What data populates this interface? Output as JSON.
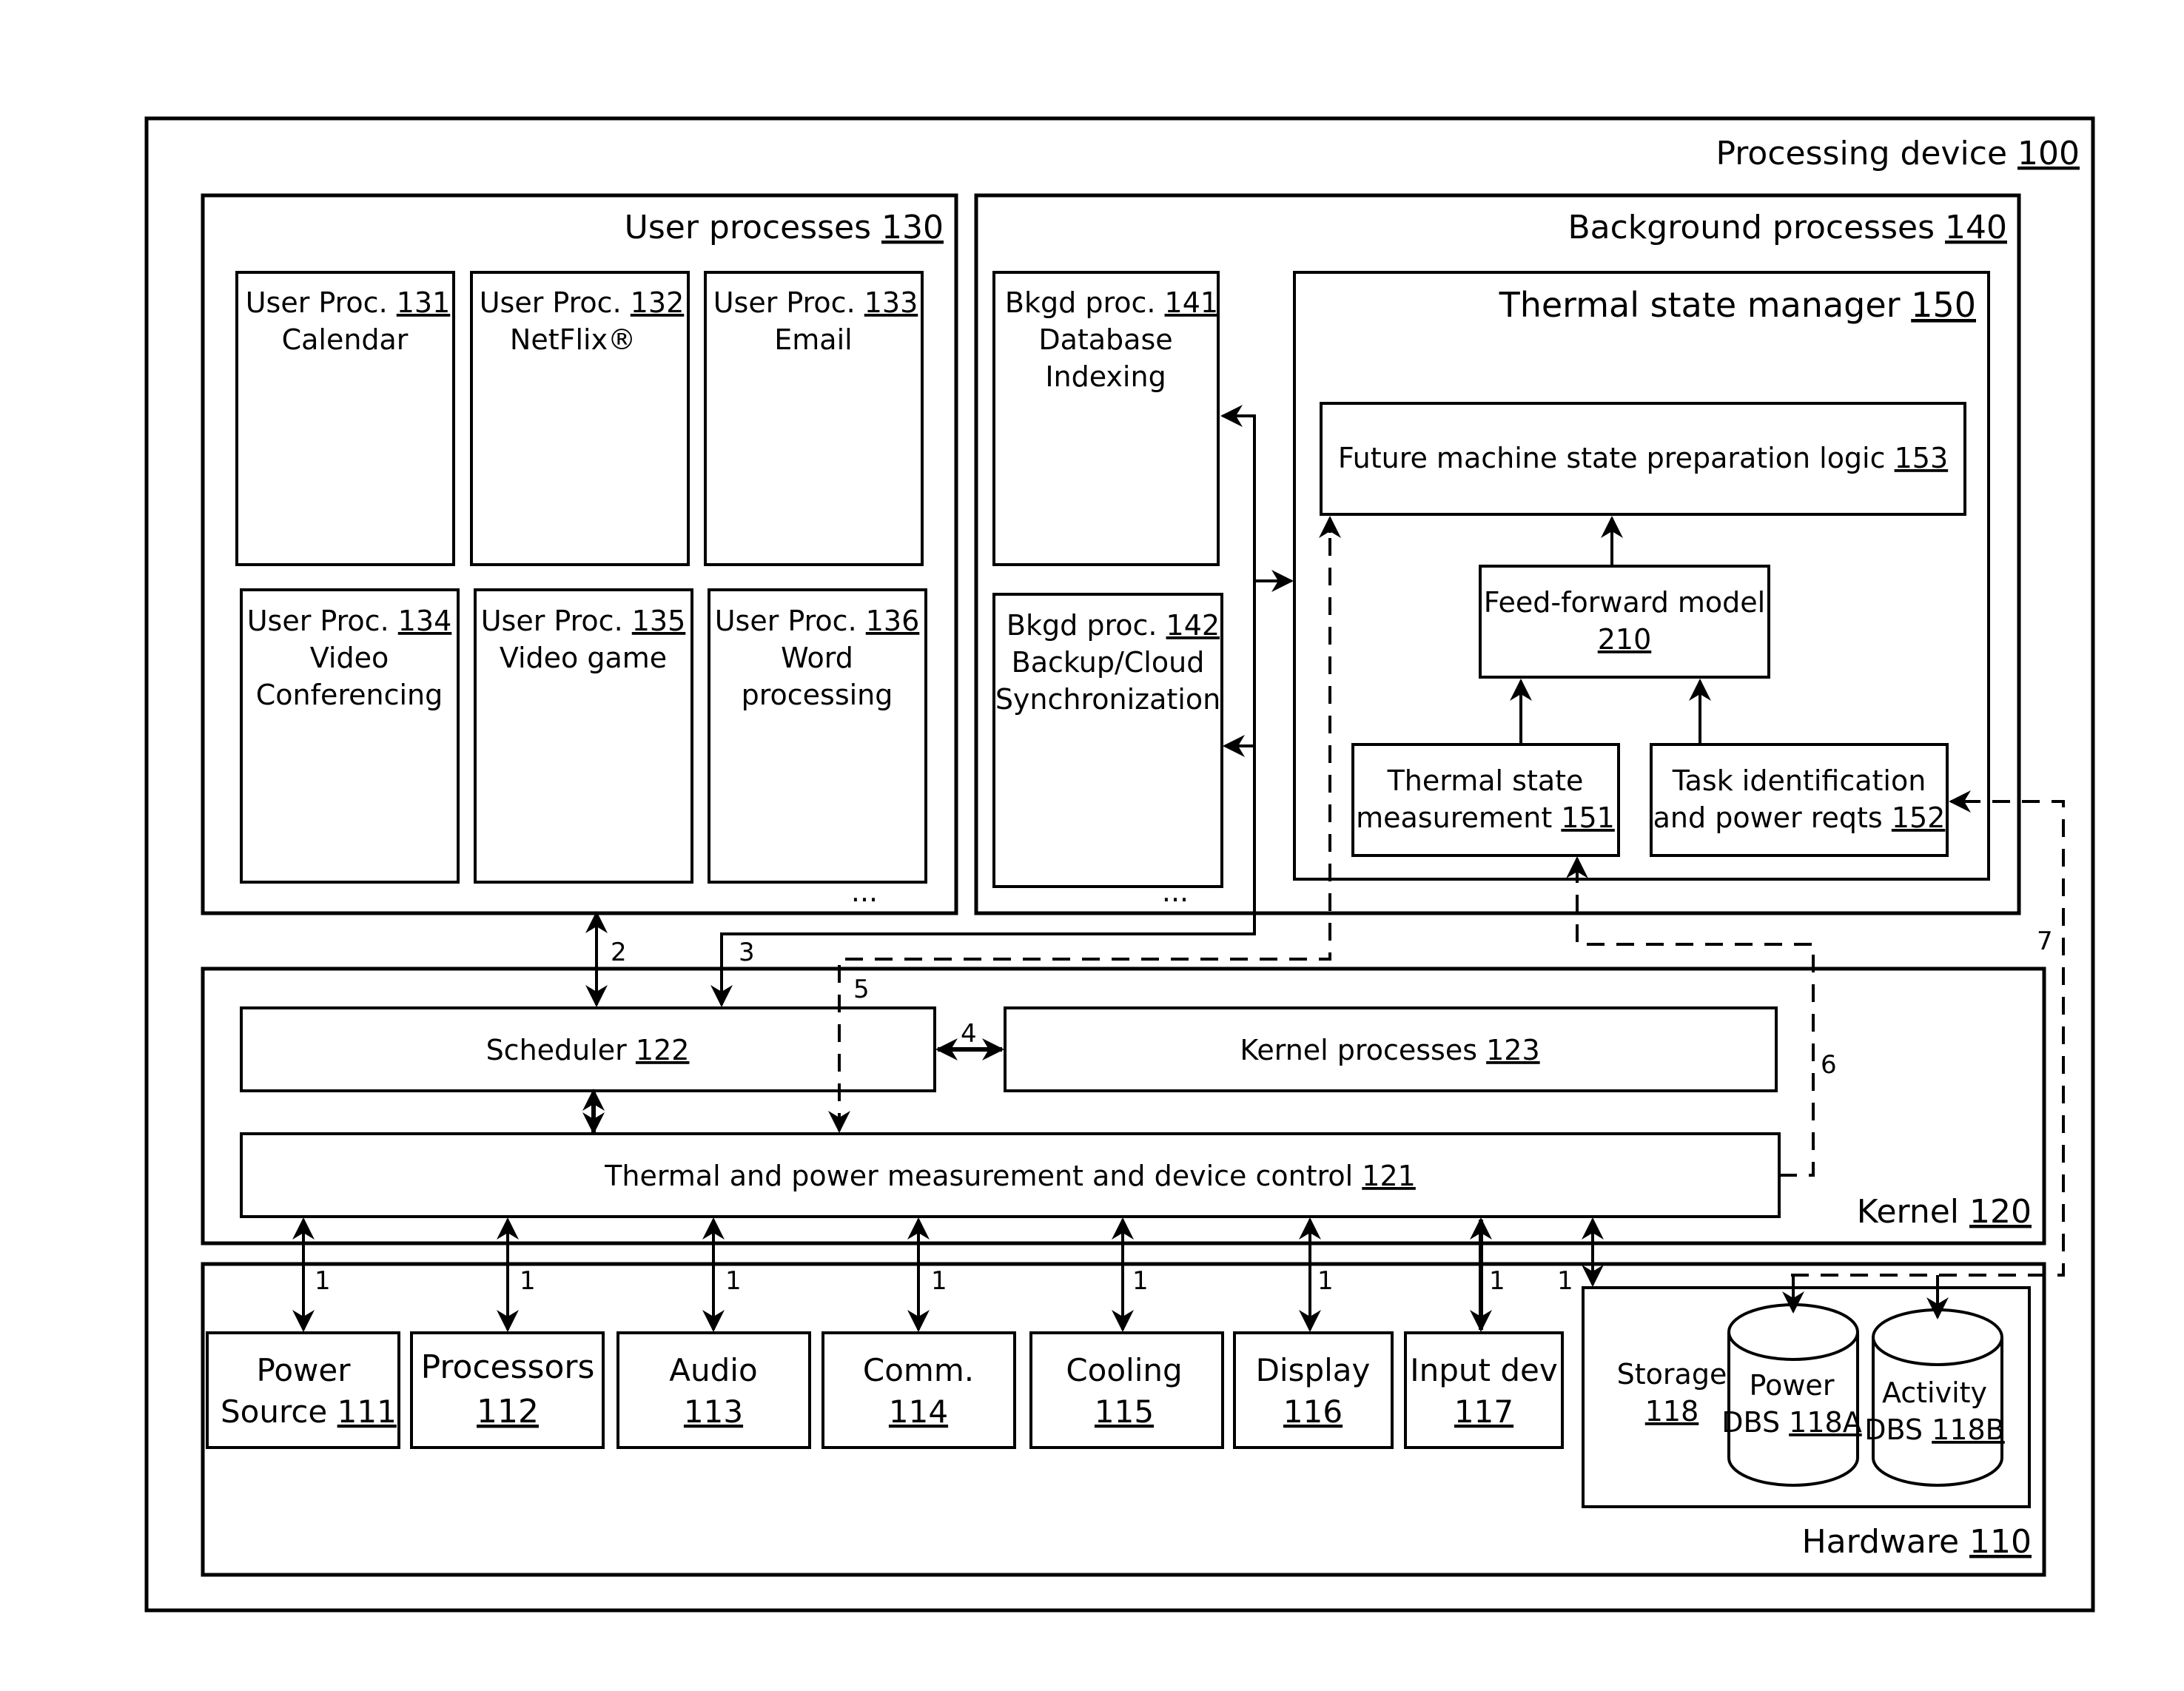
{
  "device": {
    "label": "Processing device",
    "ref": "100"
  },
  "user_processes": {
    "label": "User processes",
    "ref": "130",
    "items": [
      {
        "label": "User Proc.",
        "ref": "131",
        "lines": [
          "Calendar"
        ]
      },
      {
        "label": "User Proc.",
        "ref": "132",
        "lines": [
          "NetFlix®"
        ]
      },
      {
        "label": "User Proc.",
        "ref": "133",
        "lines": [
          "Email"
        ]
      },
      {
        "label": "User Proc.",
        "ref": "134",
        "lines": [
          "Video",
          "Conferencing"
        ]
      },
      {
        "label": "User Proc.",
        "ref": "135",
        "lines": [
          "Video game"
        ]
      },
      {
        "label": "User Proc.",
        "ref": "136",
        "lines": [
          "Word",
          "processing"
        ]
      }
    ],
    "ellipsis": "..."
  },
  "background_processes": {
    "label": "Background processes",
    "ref": "140",
    "items": [
      {
        "label": "Bkgd proc.",
        "ref": "141",
        "lines": [
          "Database",
          "Indexing"
        ]
      },
      {
        "label": "Bkgd proc.",
        "ref": "142",
        "lines": [
          "Backup/Cloud",
          "Synchronization"
        ]
      }
    ],
    "ellipsis": "..."
  },
  "thermal_state_manager": {
    "label": "Thermal state manager",
    "ref": "150",
    "future_logic": {
      "label": "Future machine state preparation logic",
      "ref": "153"
    },
    "feed_forward": {
      "label": "Feed-forward model",
      "ref": "210"
    },
    "thermal_measurement": {
      "lines": [
        "Thermal state",
        "measurement"
      ],
      "ref": "151"
    },
    "task_identification": {
      "lines": [
        "Task identification",
        "and power reqts"
      ],
      "ref": "152"
    }
  },
  "kernel": {
    "label": "Kernel",
    "ref": "120",
    "scheduler": {
      "label": "Scheduler",
      "ref": "122"
    },
    "kernel_processes": {
      "label": "Kernel processes",
      "ref": "123"
    },
    "thermal_control": {
      "label": "Thermal and power measurement and device control",
      "ref": "121"
    }
  },
  "hardware": {
    "label": "Hardware",
    "ref": "110",
    "devices": [
      {
        "lines": [
          "Power",
          "Source"
        ],
        "ref": "111"
      },
      {
        "lines": [
          "Processors"
        ],
        "ref": "112"
      },
      {
        "lines": [
          "Audio"
        ],
        "ref": "113"
      },
      {
        "lines": [
          "Comm."
        ],
        "ref": "114"
      },
      {
        "lines": [
          "Cooling"
        ],
        "ref": "115"
      },
      {
        "lines": [
          "Display"
        ],
        "ref": "116"
      },
      {
        "lines": [
          "Input dev"
        ],
        "ref": "117"
      }
    ],
    "storage": {
      "label": "Storage",
      "ref": "118",
      "power_db": {
        "label": "Power",
        "prefix": "DBS",
        "ref": "118A"
      },
      "activity_db": {
        "label": "Activity",
        "prefix": "DBS",
        "ref": "118B"
      }
    }
  },
  "connections": {
    "c1": "1",
    "c2": "2",
    "c3": "3",
    "c4": "4",
    "c5": "5",
    "c6": "6",
    "c7": "7"
  }
}
